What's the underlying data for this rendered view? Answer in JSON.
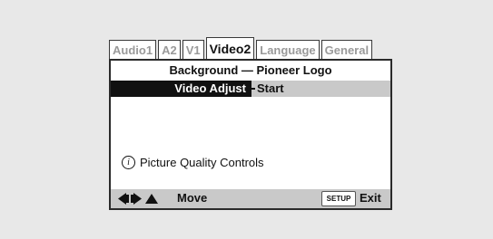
{
  "tabs": [
    {
      "label": "Audio1",
      "active": false
    },
    {
      "label": "A2",
      "active": false
    },
    {
      "label": "V1",
      "active": false
    },
    {
      "label": "Video2",
      "active": true
    },
    {
      "label": "Language",
      "active": false
    },
    {
      "label": "General",
      "active": false
    }
  ],
  "menu": {
    "background_row": "Background — Pioneer Logo",
    "selected_label": "Video Adjust",
    "selected_value": "Start"
  },
  "info": {
    "icon": "info-icon",
    "text": "Picture Quality Controls"
  },
  "footer": {
    "arrows_icon": "left-right-up-arrows-icon",
    "move_label": "Move",
    "setup_label": "SETUP",
    "exit_label": "Exit"
  },
  "colors": {
    "background": "#e8e8e8",
    "highlight": "#111111",
    "bar": "#c9c9c9",
    "inactive_tab_text": "#9a9a9a"
  }
}
